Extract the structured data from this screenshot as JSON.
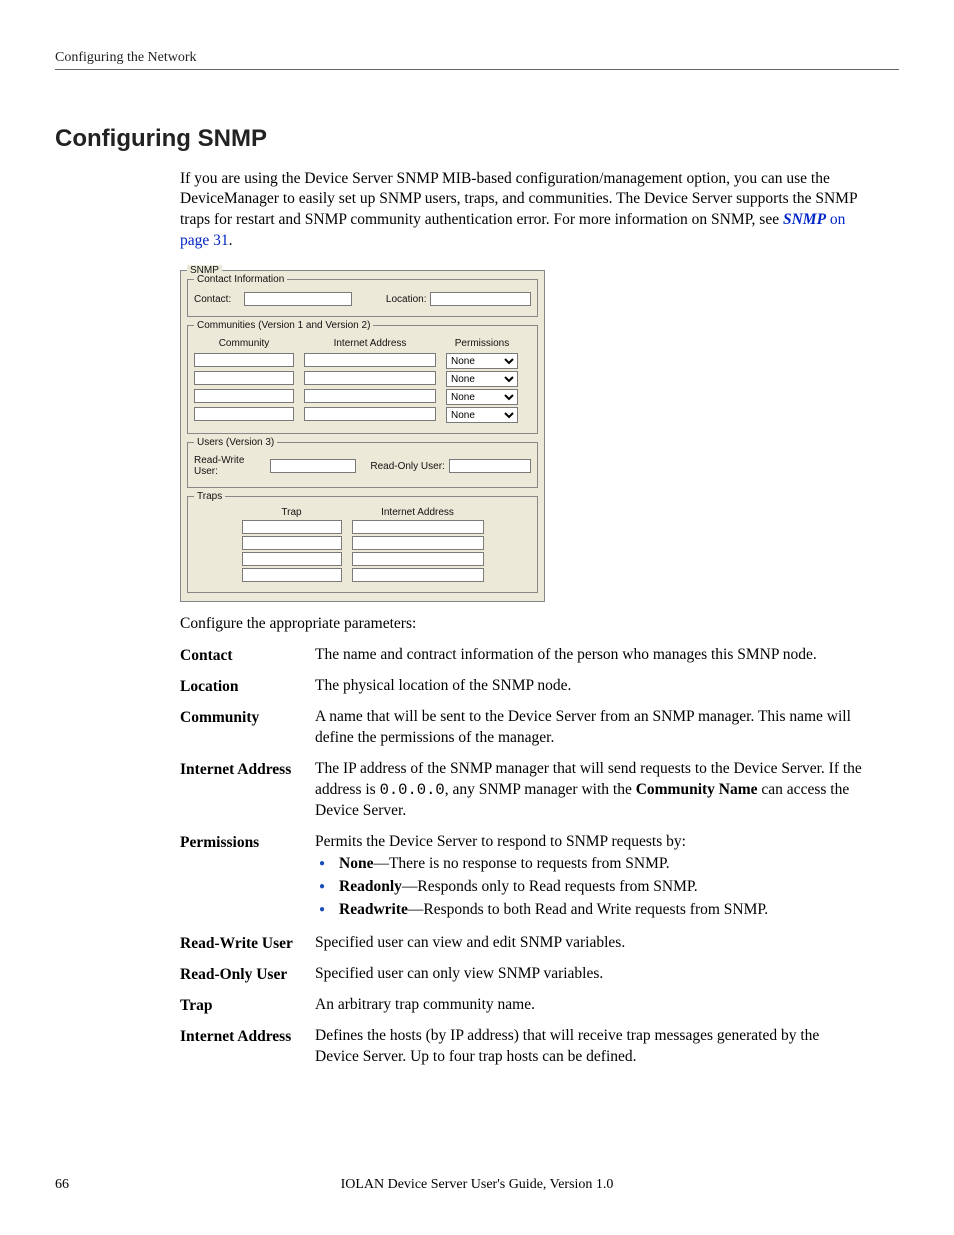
{
  "running_header": "Configuring the Network",
  "section_title": "Configuring SNMP",
  "intro": "If you are using the Device Server SNMP MIB-based configuration/management option, you can use the DeviceManager to easily set up SNMP users, traps, and communities. The Device Server supports the SNMP traps for restart and SNMP community authentication error. For more information on SNMP, see ",
  "link_text": "SNMP",
  "link_page": " on page 31",
  "intro_tail": ".",
  "dialog": {
    "outer_legend": "SNMP",
    "contact_group_legend": "Contact Information",
    "contact_lbl": "Contact:",
    "location_lbl": "Location:",
    "communities_legend": "Communities (Version 1 and Version 2)",
    "col_community": "Community",
    "col_inet": "Internet Address",
    "col_perm": "Permissions",
    "perm_default": "None",
    "users_legend": "Users (Version 3)",
    "rw_user_lbl": "Read-Write User:",
    "ro_user_lbl": "Read-Only User:",
    "traps_legend": "Traps",
    "col_trap": "Trap",
    "col_trap_inet": "Internet Address"
  },
  "params_intro": "Configure the appropriate parameters:",
  "params": {
    "contact": {
      "term": "Contact",
      "def": "The name and contract information of the person who manages this SMNP node."
    },
    "location": {
      "term": "Location",
      "def": "The physical location of the SNMP node."
    },
    "community": {
      "term": "Community",
      "def": "A name that will be sent to the Device Server from an SNMP manager. This name will define the permissions of the manager."
    },
    "inet": {
      "term": "Internet Address",
      "def_pre": "The IP address of the SNMP manager that will send requests to the Device Server. If the address is ",
      "def_addr": "0.0.0.0",
      "def_mid": ", any SNMP manager with the ",
      "def_bold": "Community Name",
      "def_post": " can access the Device Server."
    },
    "perm": {
      "term": "Permissions",
      "lead": "Permits the Device Server to respond to SNMP requests by:",
      "items": [
        {
          "b": "None",
          "rest": "—There is no response to requests from SNMP."
        },
        {
          "b": "Readonly",
          "rest": "—Responds only to Read requests from SNMP."
        },
        {
          "b": "Readwrite",
          "rest": "—Responds to both Read and Write requests from SNMP."
        }
      ]
    },
    "rwuser": {
      "term": "Read-Write User",
      "def": "Specified user can view and edit SNMP variables."
    },
    "rouser": {
      "term": "Read-Only User",
      "def": "Specified user can only view SNMP variables."
    },
    "trap": {
      "term": "Trap",
      "def": "An arbitrary trap community name."
    },
    "trap_inet": {
      "term": "Internet Address",
      "def": "Defines the hosts (by IP address) that will receive trap messages generated by the Device Server. Up to four trap hosts can be defined."
    }
  },
  "footer": {
    "page": "66",
    "manual": "IOLAN Device Server User's Guide, Version 1.0"
  }
}
